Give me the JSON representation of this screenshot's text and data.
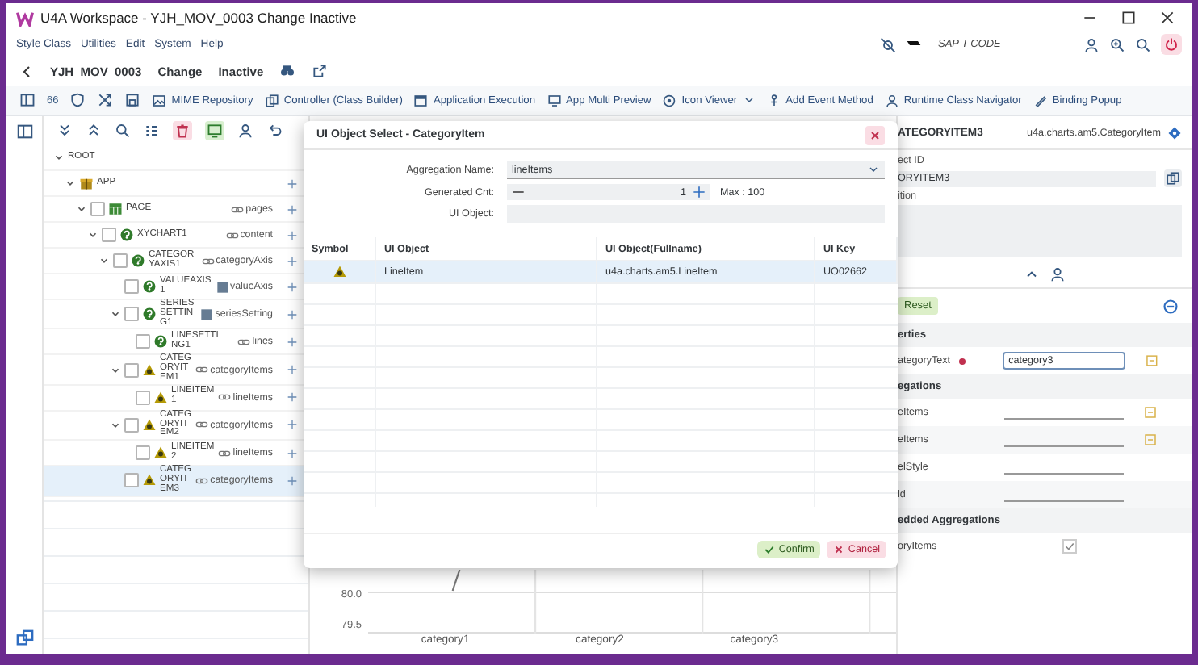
{
  "window": {
    "title": "U4A Workspace - YJH_MOV_0003 Change Inactive"
  },
  "menu": [
    "Style Class",
    "Utilities",
    "Edit",
    "System",
    "Help"
  ],
  "tcode": {
    "placeholder": "SAP T-CODE"
  },
  "header": {
    "app_id": "YJH_MOV_0003",
    "mode": "Change",
    "status": "Inactive"
  },
  "toolbar": [
    {
      "kind": "icon"
    },
    {
      "kind": "text",
      "label": "66"
    },
    {
      "kind": "icon"
    },
    {
      "kind": "icon"
    },
    {
      "kind": "icon"
    },
    {
      "kind": "labeled",
      "label": "MIME Repository"
    },
    {
      "kind": "labeled",
      "label": "Controller (Class Builder)"
    },
    {
      "kind": "labeled",
      "label": "Application Execution"
    },
    {
      "kind": "labeled",
      "label": "App Multi Preview"
    },
    {
      "kind": "dropdown",
      "label": "Icon Viewer"
    },
    {
      "kind": "labeled",
      "label": "Add Event Method"
    },
    {
      "kind": "labeled",
      "label": "Runtime Class Navigator"
    },
    {
      "kind": "labeled",
      "label": "Binding Popup"
    }
  ],
  "tree": [
    {
      "label": "ROOT",
      "expanded": true,
      "selected": false,
      "children": [
        {
          "label": "APP",
          "kind": "app",
          "expanded": true,
          "selected": false,
          "children": [
            {
              "label": "PAGE",
              "kind": "page",
              "checked": false,
              "aggregation": {
                "kind": "link",
                "label": "pages"
              },
              "expanded": true,
              "selected": false,
              "children": [
                {
                  "label": "XYCHART1",
                  "kind": "control",
                  "checked": false,
                  "aggregation": {
                    "kind": "link",
                    "label": "content"
                  },
                  "expanded": true,
                  "selected": false,
                  "children": [
                    {
                      "label": "CATEGORYAXIS1",
                      "kind": "control",
                      "checked": false,
                      "aggregation": {
                        "kind": "link",
                        "label": "categoryAxis"
                      },
                      "expanded": true,
                      "selected": false,
                      "children": [
                        {
                          "label": "VALUEAXIS1",
                          "kind": "control",
                          "checked": false,
                          "aggregation": {
                            "kind": "square",
                            "label": "valueAxis"
                          },
                          "selected": false
                        },
                        {
                          "label": "SERIESSETTING1",
                          "kind": "control",
                          "checked": false,
                          "aggregation": {
                            "kind": "square",
                            "label": "seriesSetting"
                          },
                          "expanded": true,
                          "selected": false,
                          "children": [
                            {
                              "label": "LINESETTING1",
                              "kind": "control",
                              "checked": false,
                              "aggregation": {
                                "kind": "link",
                                "label": "lines"
                              },
                              "selected": false
                            }
                          ]
                        },
                        {
                          "label": "CATEGORYITEM1",
                          "kind": "item",
                          "checked": false,
                          "aggregation": {
                            "kind": "link",
                            "label": "categoryItems"
                          },
                          "expanded": true,
                          "selected": false,
                          "children": [
                            {
                              "label": "LINEITEM1",
                              "kind": "item",
                              "checked": false,
                              "aggregation": {
                                "kind": "link",
                                "label": "lineItems"
                              },
                              "selected": false
                            }
                          ]
                        },
                        {
                          "label": "CATEGORYITEM2",
                          "kind": "item",
                          "checked": false,
                          "aggregation": {
                            "kind": "link",
                            "label": "categoryItems"
                          },
                          "expanded": true,
                          "selected": false,
                          "children": [
                            {
                              "label": "LINEITEM2",
                              "kind": "item",
                              "checked": false,
                              "aggregation": {
                                "kind": "link",
                                "label": "lineItems"
                              },
                              "selected": false
                            }
                          ]
                        },
                        {
                          "label": "CATEGORYITEM3",
                          "kind": "item",
                          "checked": false,
                          "aggregation": {
                            "kind": "link",
                            "label": "categoryItems"
                          },
                          "selected": true
                        }
                      ]
                    }
                  ]
                }
              ]
            }
          ]
        }
      ]
    }
  ],
  "chart": {
    "y_labels": [
      "80.0",
      "79.5"
    ],
    "categories": [
      "category1",
      "category2",
      "category3"
    ]
  },
  "dialog": {
    "title": "UI Object Select - CategoryItem",
    "aggregation_label": "Aggregation Name:",
    "aggregation_value": "lineItems",
    "count_label": "Generated Cnt:",
    "count_value": "1",
    "count_max": "Max : 100",
    "object_label": "UI Object:",
    "columns": [
      "Symbol",
      "UI Object",
      "UI Object(Fullname)",
      "UI Key"
    ],
    "rows": [
      {
        "kind": "item",
        "object": "LineItem",
        "fullname": "u4a.charts.am5.LineItem",
        "key": "UO02662",
        "selected": true
      }
    ],
    "confirm": "Confirm",
    "cancel": "Cancel"
  },
  "properties": {
    "title": "ATEGORYITEM3",
    "class_name": "u4a.charts.am5.CategoryItem",
    "id_label": "ect ID",
    "id_value": "ORYITEM3",
    "desc_label": "ition",
    "reset": "Reset",
    "sections": [
      {
        "title": "erties",
        "rows": [
          {
            "kind": "input",
            "label": "ategoryText",
            "required": true,
            "value": "category3",
            "bindable": true
          }
        ]
      },
      {
        "title": "egations",
        "rows": [
          {
            "kind": "line",
            "label": "eItems",
            "bindable": true
          },
          {
            "kind": "line",
            "label": "eItems",
            "bindable": true
          },
          {
            "kind": "line",
            "label": "elStyle",
            "bindable": false
          },
          {
            "kind": "line",
            "label": "ld",
            "bindable": false
          }
        ]
      },
      {
        "title": "edded Aggregations",
        "rows": [
          {
            "kind": "check",
            "label": "oryItems",
            "checked": true
          }
        ]
      }
    ]
  }
}
